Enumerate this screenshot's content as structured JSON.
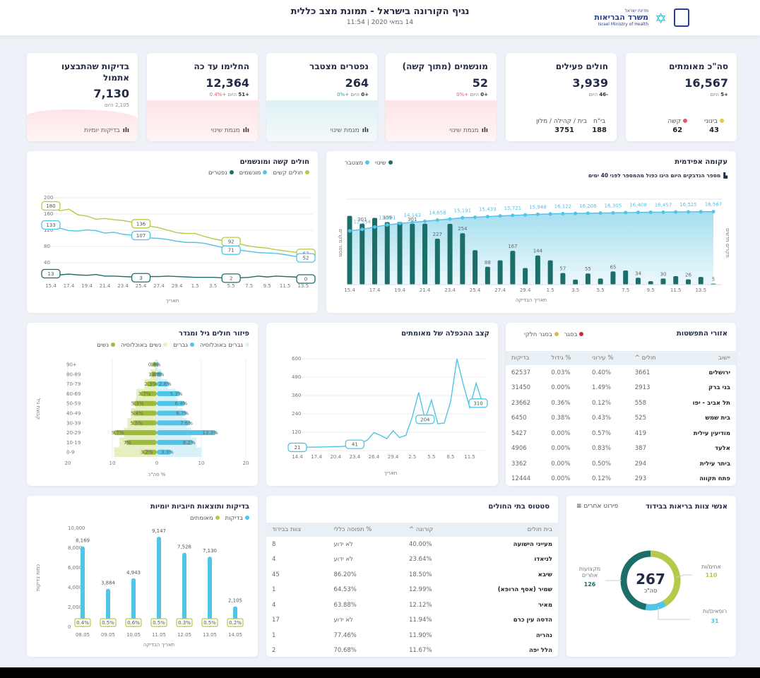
{
  "header": {
    "title": "נגיף הקורונה בישראל - תמונת מצב כללית",
    "subtitle": "14 במאי 2020 | 11:54",
    "logo_top": "מדינת ישראל",
    "logo_name": "משרד הבריאות",
    "logo_en": "Israel Ministry of Health"
  },
  "stats": [
    {
      "title": "סה\"כ מאומתים",
      "value": "16,567",
      "change": "+5",
      "today": "היום",
      "sub": [
        {
          "label": "בינוני",
          "value": "43",
          "color": "#e8c547"
        },
        {
          "label": "קשה",
          "value": "62",
          "color": "#e5586b"
        }
      ]
    },
    {
      "title": "חולים פעילים",
      "value": "3,939",
      "change": "-46",
      "today": "היום",
      "sub": [
        {
          "label": "בי\"ח",
          "value": "188"
        },
        {
          "label": "בית / קהילה / מלון",
          "value": "3751"
        }
      ]
    },
    {
      "title": "מונשמים (מתוך קשה)",
      "value": "52",
      "change": "+0",
      "today": "היום",
      "pct": "+0%",
      "trend": "מגמת שינוי"
    },
    {
      "title": "נפטרים מצטבר",
      "value": "264",
      "change": "+0",
      "today": "היום",
      "pct": "+0%",
      "trend": "מגמת שינוי"
    },
    {
      "title": "החלימו עד כה",
      "value": "12,364",
      "change": "+51",
      "today": "היום",
      "pct": "+0.4%",
      "trend": "מגמת שינוי"
    },
    {
      "title": "בדיקות שהתבצעו אתמול",
      "value": "7,130",
      "change": "2,105",
      "today": "היום",
      "trend": "בדיקות יומיות"
    }
  ],
  "colors": {
    "teal": "#1c6e6b",
    "blue": "#50c5e8",
    "green": "#b5c94a",
    "red": "#e5586b",
    "yellow": "#e8c547"
  },
  "chart_data": [
    {
      "type": "bar",
      "title": "עקומה אפידמית",
      "note": "מספר הנדבקים היום הינו כפול מהמספר לפני 40 ימים",
      "legend": [
        "שינוי",
        "מצטבר"
      ],
      "ylabel": "מספר מקרים",
      "ylabel_right": "מקרים חדשים",
      "xlabel": "תאריך הבדיקה",
      "x": [
        "15.4",
        "16.4",
        "17.4",
        "18.4",
        "19.4",
        "20.4",
        "21.4",
        "22.4",
        "23.4",
        "24.4",
        "25.4",
        "26.4",
        "27.4",
        "28.4",
        "29.4",
        "30.4",
        "1.5",
        "2.5",
        "3.5",
        "4.5",
        "5.5",
        "6.5",
        "7.5",
        "8.5",
        "9.5",
        "10.5",
        "11.5",
        "12.5",
        "13.5",
        "14.5"
      ],
      "series": [
        {
          "name": "שינוי",
          "type": "bar",
          "values": [
            340,
            301,
            330,
            309,
            310,
            301,
            301,
            227,
            300,
            254,
            170,
            88,
            120,
            167,
            82,
            144,
            120,
            57,
            25,
            55,
            30,
            65,
            70,
            34,
            17,
            30,
            42,
            26,
            38,
            5
          ],
          "labeled": [
            false,
            true,
            false,
            true,
            false,
            true,
            false,
            true,
            false,
            true,
            false,
            true,
            false,
            true,
            false,
            true,
            false,
            true,
            false,
            true,
            false,
            true,
            false,
            true,
            false,
            true,
            false,
            true,
            false,
            true
          ]
        },
        {
          "name": "מצטבר",
          "type": "line",
          "values": [
            12200,
            12554,
            13100,
            13561,
            13900,
            14143,
            14400,
            14658,
            14900,
            15191,
            15300,
            15439,
            15600,
            15721,
            15830,
            15948,
            16050,
            16122,
            16170,
            16206,
            16250,
            16305,
            16350,
            16408,
            16430,
            16457,
            16490,
            16525,
            16550,
            16567
          ]
        }
      ],
      "bar_max": 370,
      "line_max": 17000
    },
    {
      "type": "line",
      "title": "חולים קשה ומונשמים",
      "legend": [
        "חולים קשים",
        "מונשמים",
        "נפטרים"
      ],
      "xlabel": "תאריך",
      "ylim": [
        0,
        200
      ],
      "yticks": [
        40,
        80,
        120,
        160,
        200
      ],
      "x": [
        "15.4",
        "16.4",
        "17.4",
        "18.4",
        "19.4",
        "20.4",
        "21.4",
        "22.4",
        "23.4",
        "24.4",
        "25.4",
        "26.4",
        "27.4",
        "28.4",
        "29.4",
        "30.4",
        "1.5",
        "2.5",
        "3.5",
        "4.5",
        "5.5",
        "6.5",
        "7.5",
        "8.5",
        "9.5",
        "10.5",
        "11.5",
        "12.5",
        "13.5",
        "14.5"
      ],
      "xticks": [
        "15.4",
        "17.4",
        "19.4",
        "21.4",
        "23.4",
        "25.4",
        "27.4",
        "29.4",
        "1.5",
        "3.5",
        "5.5",
        "7.5",
        "9.5",
        "11.5",
        "13.5"
      ],
      "series": [
        {
          "name": "חולים קשים",
          "values": [
            180,
            168,
            172,
            158,
            155,
            147,
            149,
            146,
            144,
            140,
            136,
            130,
            126,
            120,
            114,
            112,
            112,
            105,
            99,
            95,
            92,
            86,
            81,
            78,
            76,
            72,
            69,
            66,
            63,
            63
          ]
        },
        {
          "name": "מונשמים",
          "values": [
            133,
            125,
            119,
            118,
            121,
            119,
            113,
            115,
            110,
            108,
            107,
            101,
            100,
            97,
            93,
            90,
            90,
            88,
            83,
            78,
            71,
            71,
            68,
            65,
            64,
            63,
            60,
            56,
            53,
            52
          ]
        },
        {
          "name": "נפטרים",
          "values": [
            13,
            10,
            12,
            10,
            9,
            11,
            7,
            7,
            6,
            5,
            3,
            6,
            6,
            7,
            6,
            5,
            4,
            4,
            4,
            3,
            2,
            3,
            4,
            7,
            5,
            7,
            6,
            5,
            2,
            0
          ]
        }
      ],
      "label_idx": [
        0,
        10,
        20,
        29
      ]
    },
    {
      "type": "bar",
      "title": "פיזור חולים גיל ומגדר",
      "legend": [
        "גברים באוכלוסיה",
        "גברים",
        "נשים באוכלוסיה",
        "נשים"
      ],
      "ylabel": "קבוצת גיל",
      "xlabel": "% סה\"כ",
      "xticks": [
        "20",
        "10",
        "0",
        "10",
        "20"
      ],
      "categories": [
        "+90",
        "80-89",
        "70-79",
        "60-69",
        "50-59",
        "40-49",
        "30-39",
        "20-29",
        "10-19",
        "0-9"
      ],
      "women": [
        1,
        1.4,
        2.3,
        3.7,
        5.3,
        5.4,
        5.5,
        9.7,
        7,
        3.2
      ],
      "men": [
        0.4,
        1.2,
        2.8,
        5.3,
        6.4,
        6.7,
        7.6,
        13.3,
        8.2,
        3.3
      ],
      "women_labels": [
        "1%",
        "1.4%",
        "2.3%",
        "3.7%",
        "5.3%",
        "5.4%",
        "5.5%",
        "9.7%",
        "7%",
        "3.2%"
      ],
      "men_labels": [
        "0.4%",
        "1.2%",
        "2.8%",
        "5.3%",
        "6.4%",
        "6.7%",
        "7.6%",
        "13.3%",
        "8.2%",
        "3.3%"
      ],
      "women_pop": [
        0.4,
        1.4,
        2.8,
        4.6,
        4.8,
        5.8,
        6.6,
        7.4,
        8.4,
        9.6
      ],
      "men_pop": [
        0.2,
        1,
        2.4,
        4.3,
        4.7,
        5.8,
        6.7,
        7.7,
        8.9,
        10.1
      ]
    },
    {
      "type": "line",
      "title": "קצב ההכפלה של מאומתים",
      "xlabel": "תאריך",
      "ylim": [
        0,
        600
      ],
      "yticks": [
        120,
        240,
        360,
        480,
        600
      ],
      "x": [
        "14.4",
        "15.4",
        "16.4",
        "17.4",
        "18.4",
        "19.4",
        "20.4",
        "21.4",
        "22.4",
        "23.4",
        "24.4",
        "25.4",
        "26.4",
        "27.4",
        "28.4",
        "29.4",
        "30.4",
        "1.5",
        "2.5",
        "3.5",
        "4.5",
        "5.5",
        "6.5",
        "7.5",
        "8.5",
        "9.5",
        "10.5",
        "11.5",
        "12.5",
        "13.5"
      ],
      "xticks": [
        "14.4",
        "17.4",
        "20.4",
        "23.4",
        "26.4",
        "29.4",
        "2.5",
        "5.5",
        "8.5",
        "11.5"
      ],
      "values": [
        21,
        22,
        22,
        23,
        24,
        25,
        26,
        27,
        30,
        41,
        50,
        70,
        118,
        100,
        78,
        130,
        85,
        100,
        220,
        380,
        204,
        330,
        175,
        180,
        320,
        600,
        430,
        280,
        440,
        310
      ],
      "label_idx": [
        0,
        9,
        20,
        29
      ]
    },
    {
      "type": "bar",
      "title": "בדיקות ותוצאות חיוביות יומיות",
      "legend": [
        "בדיקות",
        "מאומתים"
      ],
      "ylabel": "כמות בדיקות",
      "xlabel": "תאריך הבדיקה",
      "ylim": [
        0,
        10000
      ],
      "yticks": [
        "0",
        "2,000",
        "4,000",
        "6,000",
        "8,000",
        "10,000"
      ],
      "categories": [
        "08.05",
        "09.05",
        "10.05",
        "11.05",
        "12.05",
        "13.05",
        "14.05"
      ],
      "values": [
        8169,
        3884,
        4943,
        9147,
        7528,
        7130,
        2105
      ],
      "value_labels": [
        "8,169",
        "3,884",
        "4,943",
        "9,147",
        "7,528",
        "7,130",
        "2,105"
      ],
      "positive": [
        "0.4%",
        "0.5%",
        "0.6%",
        "0.5%",
        "0.3%",
        "0.5%",
        "0.2%"
      ]
    },
    {
      "type": "pie",
      "title": "אנשי צוות בריאות בבידוד",
      "menu": "פירוט אחרים",
      "total": "267",
      "total_label": "סה\"כ",
      "slices": [
        {
          "label": "אחים/ות",
          "value": 110,
          "color": "#b5c94a"
        },
        {
          "label": "רופאים/ות",
          "value": 31,
          "color": "#50c5e8"
        },
        {
          "label": "מקצועות אחרים",
          "value": 126,
          "color": "#1c6e6b"
        }
      ]
    }
  ],
  "regions": {
    "title": "אזורי התפשטות",
    "legend": [
      "בסגר",
      "בסגר חלקי"
    ],
    "columns": [
      "יישוב",
      "חולים ^",
      "% עירוני",
      "% גידול",
      "בדיקות"
    ],
    "rows": [
      [
        "ירושלים",
        "3661",
        "0.40%",
        "0.03%",
        "62537"
      ],
      [
        "בני ברק",
        "2913",
        "1.49%",
        "0.00%",
        "31450"
      ],
      [
        "תל אביב - יפו",
        "558",
        "0.12%",
        "0.36%",
        "23662"
      ],
      [
        "בית שמש",
        "525",
        "0.43%",
        "0.38%",
        "6450"
      ],
      [
        "מודיעין עילית",
        "419",
        "0.57%",
        "0.00%",
        "5427"
      ],
      [
        "אלעד",
        "387",
        "0.83%",
        "0.00%",
        "4906"
      ],
      [
        "ביתר עילית",
        "294",
        "0.50%",
        "0.00%",
        "3362"
      ],
      [
        "פתח תקווה",
        "293",
        "0.12%",
        "0.00%",
        "12444"
      ]
    ]
  },
  "hospitals": {
    "title": "סטטוס בתי החולים",
    "columns": [
      "בית חולים",
      "קורונה ^",
      "% תפוסה כללי",
      "צוות בבידוד"
    ],
    "rows": [
      [
        "מעייני הישועה",
        "40.00%",
        "לא ידוע",
        "8"
      ],
      [
        "לניאדו",
        "23.64%",
        "לא ידוע",
        "4"
      ],
      [
        "שיבא",
        "18.50%",
        "86.20%",
        "45"
      ],
      [
        "שמיר (אסף הרופא)",
        "12.99%",
        "64.53%",
        "1"
      ],
      [
        "מאיר",
        "12.12%",
        "63.88%",
        "4"
      ],
      [
        "הדסה עין כרם",
        "11.94%",
        "לא ידוע",
        "17"
      ],
      [
        "נהריה",
        "11.90%",
        "77.46%",
        "1"
      ],
      [
        "הלל יפה",
        "11.67%",
        "70.68%",
        "2"
      ]
    ]
  }
}
